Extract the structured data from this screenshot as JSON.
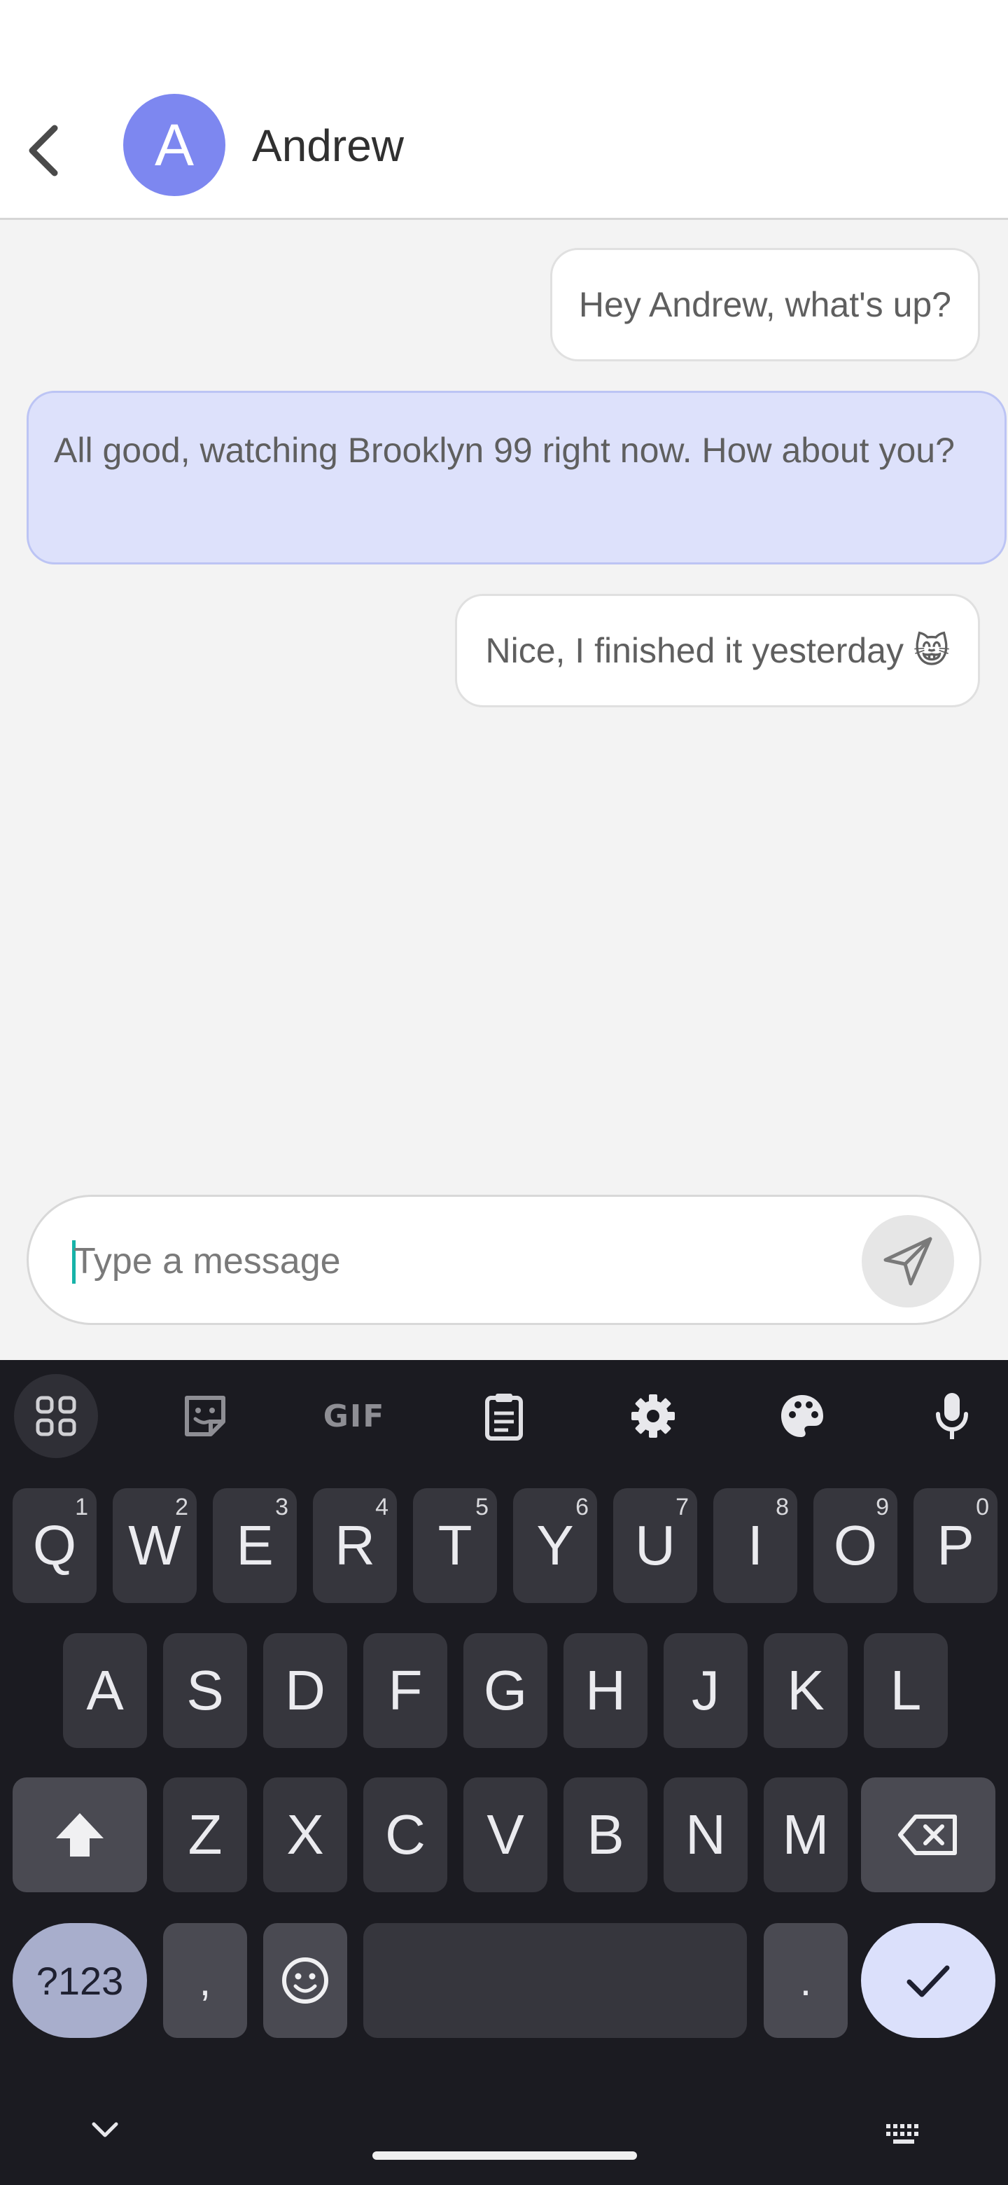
{
  "header": {
    "back_icon": "chevron-left-icon",
    "avatar_letter": "A",
    "contact_name": "Andrew"
  },
  "messages": [
    {
      "text": "Hey Andrew, what's up?",
      "direction": "outgoing"
    },
    {
      "text": "All good, watching Brooklyn 99 right now. How about you?",
      "direction": "incoming"
    },
    {
      "text": "Nice, I finished it yesterday 😸",
      "direction": "outgoing"
    }
  ],
  "composer": {
    "placeholder": "Type a message",
    "value": "",
    "send_icon": "send-icon"
  },
  "keyboard": {
    "toolbar": [
      "apps-grid-icon",
      "sticker-icon",
      "GIF",
      "clipboard-icon",
      "gear-icon",
      "palette-icon",
      "microphone-icon"
    ],
    "gif_label": "GIF",
    "row1": [
      {
        "k": "Q",
        "h": "1"
      },
      {
        "k": "W",
        "h": "2"
      },
      {
        "k": "E",
        "h": "3"
      },
      {
        "k": "R",
        "h": "4"
      },
      {
        "k": "T",
        "h": "5"
      },
      {
        "k": "Y",
        "h": "6"
      },
      {
        "k": "U",
        "h": "7"
      },
      {
        "k": "I",
        "h": "8"
      },
      {
        "k": "O",
        "h": "9"
      },
      {
        "k": "P",
        "h": "0"
      }
    ],
    "row2": [
      "A",
      "S",
      "D",
      "F",
      "G",
      "H",
      "J",
      "K",
      "L"
    ],
    "row3": [
      "Z",
      "X",
      "C",
      "V",
      "B",
      "N",
      "M"
    ],
    "symbols_label": "?123",
    "comma_label": ",",
    "period_label": ".",
    "shift_icon": "shift-icon",
    "backspace_icon": "backspace-icon",
    "emoji_icon": "emoji-icon",
    "enter_icon": "checkmark-icon"
  },
  "navbar": {
    "hide_icon": "chevron-down-icon",
    "switch_icon": "keyboard-icon"
  },
  "colors": {
    "accent": "#7d87f0",
    "incoming_bubble": "#dde1fb",
    "keyboard_bg": "#1b1b21",
    "key_bg": "#36363d",
    "caret": "#17b3a8"
  }
}
